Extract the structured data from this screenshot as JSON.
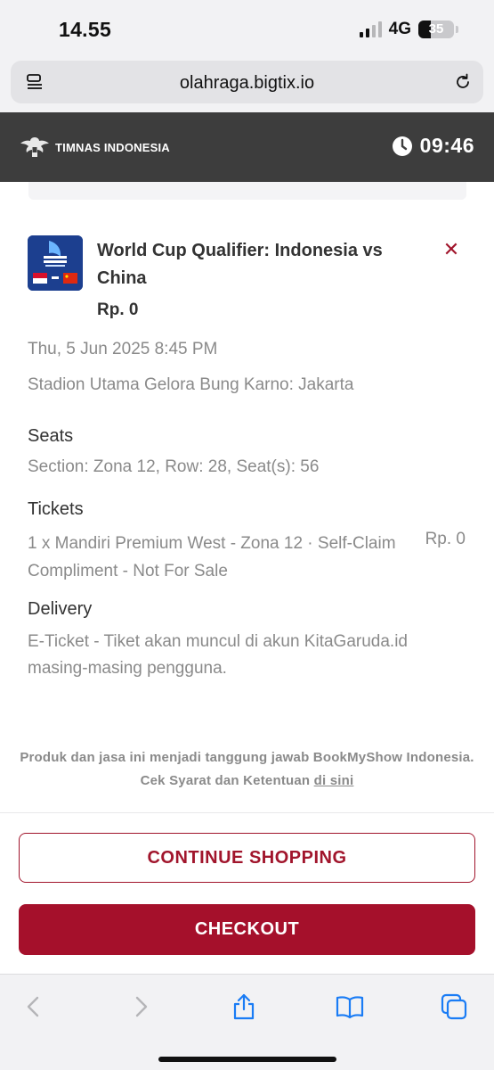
{
  "status_bar": {
    "time": "14.55",
    "network": "4G",
    "battery": "35",
    "battery_level": 0.35
  },
  "browser": {
    "url": "olahraga.bigtix.io",
    "icons": [
      "reader-icon",
      "reload-icon"
    ]
  },
  "header": {
    "brand": "TIMNAS INDONESIA",
    "timer": "09:46",
    "icons": [
      "garuda-logo-icon",
      "clock-icon"
    ]
  },
  "event": {
    "title": "World Cup Qualifier: Indonesia vs China",
    "price": "Rp. 0",
    "date": "Thu, 5 Jun 2025 8:45 PM",
    "venue": "Stadion Utama Gelora Bung Karno: Jakarta",
    "remove_icon": "close-icon"
  },
  "seats": {
    "label": "Seats",
    "value": "Section: Zona 12, Row: 28, Seat(s): 56"
  },
  "tickets": {
    "label": "Tickets",
    "description": "1 x Mandiri Premium West - Zona 12 · Self-Claim Compliment - Not For Sale",
    "price": "Rp. 0"
  },
  "delivery": {
    "label": "Delivery",
    "description": "E-Ticket - Tiket akan muncul di akun KitaGaruda.id masing-masing pengguna."
  },
  "disclaimer": {
    "text": "Produk dan jasa ini menjadi tanggung jawab BookMyShow Indonesia. Cek Syarat dan Ketentuan ",
    "link": "di sini"
  },
  "actions": {
    "continue_label": "CONTINUE SHOPPING",
    "checkout_label": "CHECKOUT"
  },
  "toolbar": {
    "icons": [
      "back-icon",
      "forward-icon",
      "share-icon",
      "bookmarks-icon",
      "tabs-icon"
    ]
  },
  "colors": {
    "accent": "#a5102b",
    "header_bg": "#3d3d3d",
    "muted_text": "#8a8a8a"
  }
}
